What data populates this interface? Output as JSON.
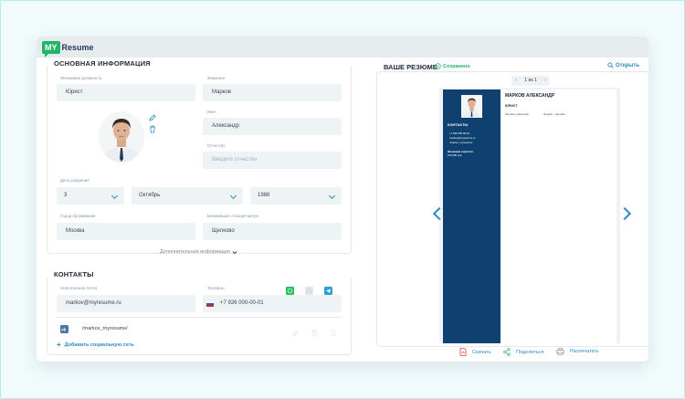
{
  "logo": {
    "badge": "MY",
    "word": "Resume"
  },
  "basic": {
    "title": "ОСНОВНАЯ ИНФОРМАЦИЯ",
    "position_label": "Желаемая должность",
    "position_value": "Юрист",
    "surname_label": "Фамилия",
    "surname_value": "Марков",
    "name_label": "Имя",
    "name_value": "Александр",
    "patronymic_label": "Отчество",
    "patronymic_placeholder": "Введите отчество",
    "birth_label": "Дата рождения",
    "birth_day": "3",
    "birth_month": "Октябрь",
    "birth_year": "1988",
    "city_label": "Город проживания",
    "city_value": "Москва",
    "metro_label": "Ближайшая станция метро",
    "metro_value": "Щелково",
    "more_info": "Дополнительная информация"
  },
  "contacts": {
    "title": "КОНТАКТЫ",
    "email_label": "Электронная почта",
    "email_value": "markov@myresume.ru",
    "phone_label": "Телефон",
    "phone_value": "+7 926 000-00-01",
    "social_value": "/markov_myresume/",
    "add_social": "Добавить социальную сеть"
  },
  "resume": {
    "title": "ВАШЕ РЕЗЮМЕ",
    "saved": "Сохранено",
    "open": "Открыть",
    "pager": "1 из 1",
    "doc_name": "МАРКОВ АЛЕКСАНДР",
    "doc_position": "ЮРИСТ",
    "doc_city": "Москва и Щёлково",
    "doc_schedule": "Формат: Офлайн",
    "doc_contacts_title": "КОНТАКТЫ",
    "doc_phone": "+7 926 000-00-01",
    "doc_email": "markov@myresume.ru",
    "doc_social": "/markov_myresume/",
    "doc_salary_label": "Желаемая зарплата:",
    "doc_salary_value": "100 000 руб."
  },
  "actions": {
    "download": "Скачать",
    "share": "Поделиться",
    "print": "Распечатать"
  },
  "colors": {
    "accent": "#2b8bc6",
    "brand_green": "#23b46b",
    "doc_sidebar": "#0f4170"
  }
}
